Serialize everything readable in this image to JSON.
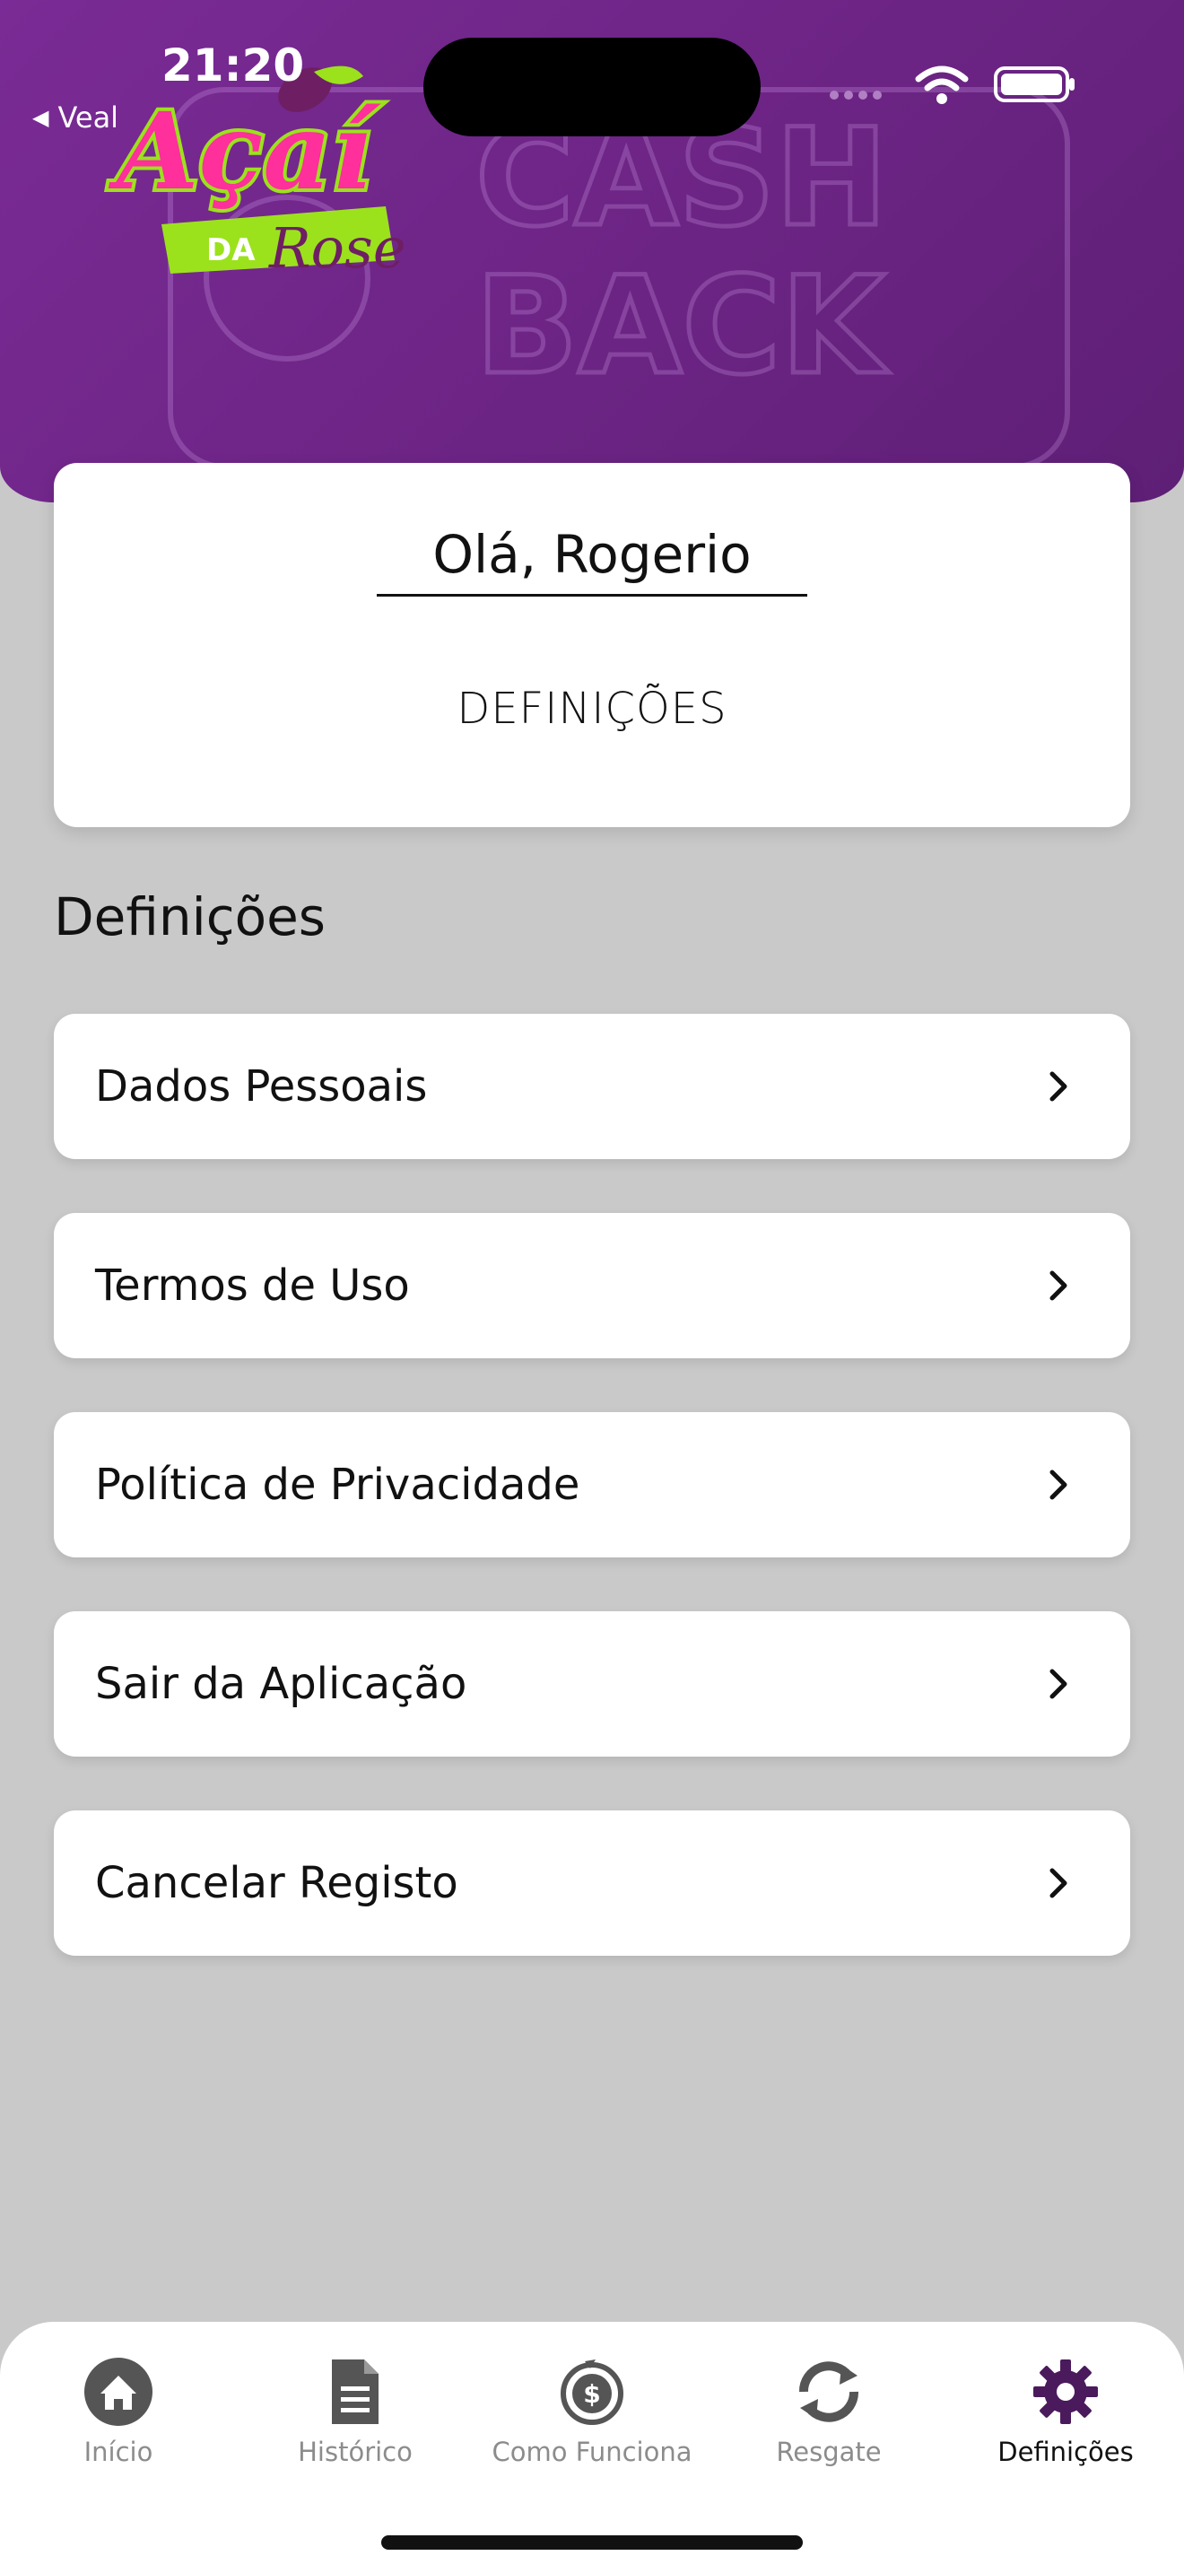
{
  "status_bar": {
    "time": "21:20",
    "back_label": "Veal"
  },
  "header": {
    "bg_text_1": "CASH",
    "bg_text_2": "BACK",
    "logo_top": "Açaí",
    "logo_mid": "DA",
    "logo_bottom": "Rose"
  },
  "greeting": {
    "name": "Olá, Rogerio",
    "subtitle": "DEFINIÇÕES"
  },
  "section": {
    "title": "Definições"
  },
  "menu": [
    {
      "label": "Dados Pessoais"
    },
    {
      "label": "Termos de Uso"
    },
    {
      "label": "Política de Privacidade"
    },
    {
      "label": "Sair da Aplicação"
    },
    {
      "label": "Cancelar Registo"
    }
  ],
  "nav": [
    {
      "label": "Início",
      "icon": "home-icon"
    },
    {
      "label": "Histórico",
      "icon": "document-icon"
    },
    {
      "label": "Como Funciona",
      "icon": "dollar-cycle-icon"
    },
    {
      "label": "Resgate",
      "icon": "refresh-icon"
    },
    {
      "label": "Definições",
      "icon": "gear-icon",
      "active": true
    }
  ],
  "colors": {
    "header": "#6c2484",
    "accent": "#4a1a5c",
    "page_bg": "#c9c9c9",
    "inactive_icon": "#555555",
    "logo_pink": "#ff2f9b",
    "logo_green": "#9be21c"
  }
}
